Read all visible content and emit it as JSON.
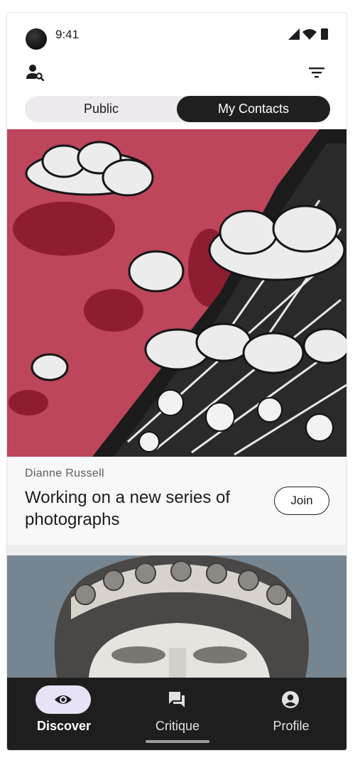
{
  "status_bar": {
    "time": "9:41",
    "icons": [
      "signal-icon",
      "wifi-icon",
      "battery-icon"
    ]
  },
  "top_bar": {
    "left_icon": "person-search-icon",
    "right_icon": "filter-icon"
  },
  "segmented_control": {
    "options": [
      {
        "label": "Public",
        "selected": false
      },
      {
        "label": "My Contacts",
        "selected": true
      }
    ]
  },
  "feed": [
    {
      "author": "Dianne Russell",
      "title": "Working on a new series of photographs",
      "action_label": "Join",
      "image": "street-art-mural-photo"
    },
    {
      "image": "marble-statue-photo"
    }
  ],
  "bottom_nav": {
    "items": [
      {
        "label": "Discover",
        "icon": "eye-icon",
        "active": true
      },
      {
        "label": "Critique",
        "icon": "chat-icon",
        "active": false
      },
      {
        "label": "Profile",
        "icon": "account-circle-icon",
        "active": false
      }
    ]
  },
  "colors": {
    "accent_pill": "#e9e1f5",
    "segment_selected": "#1f1f1f",
    "nav_background": "#1e1e1e",
    "mural_red": "#c2485f"
  }
}
